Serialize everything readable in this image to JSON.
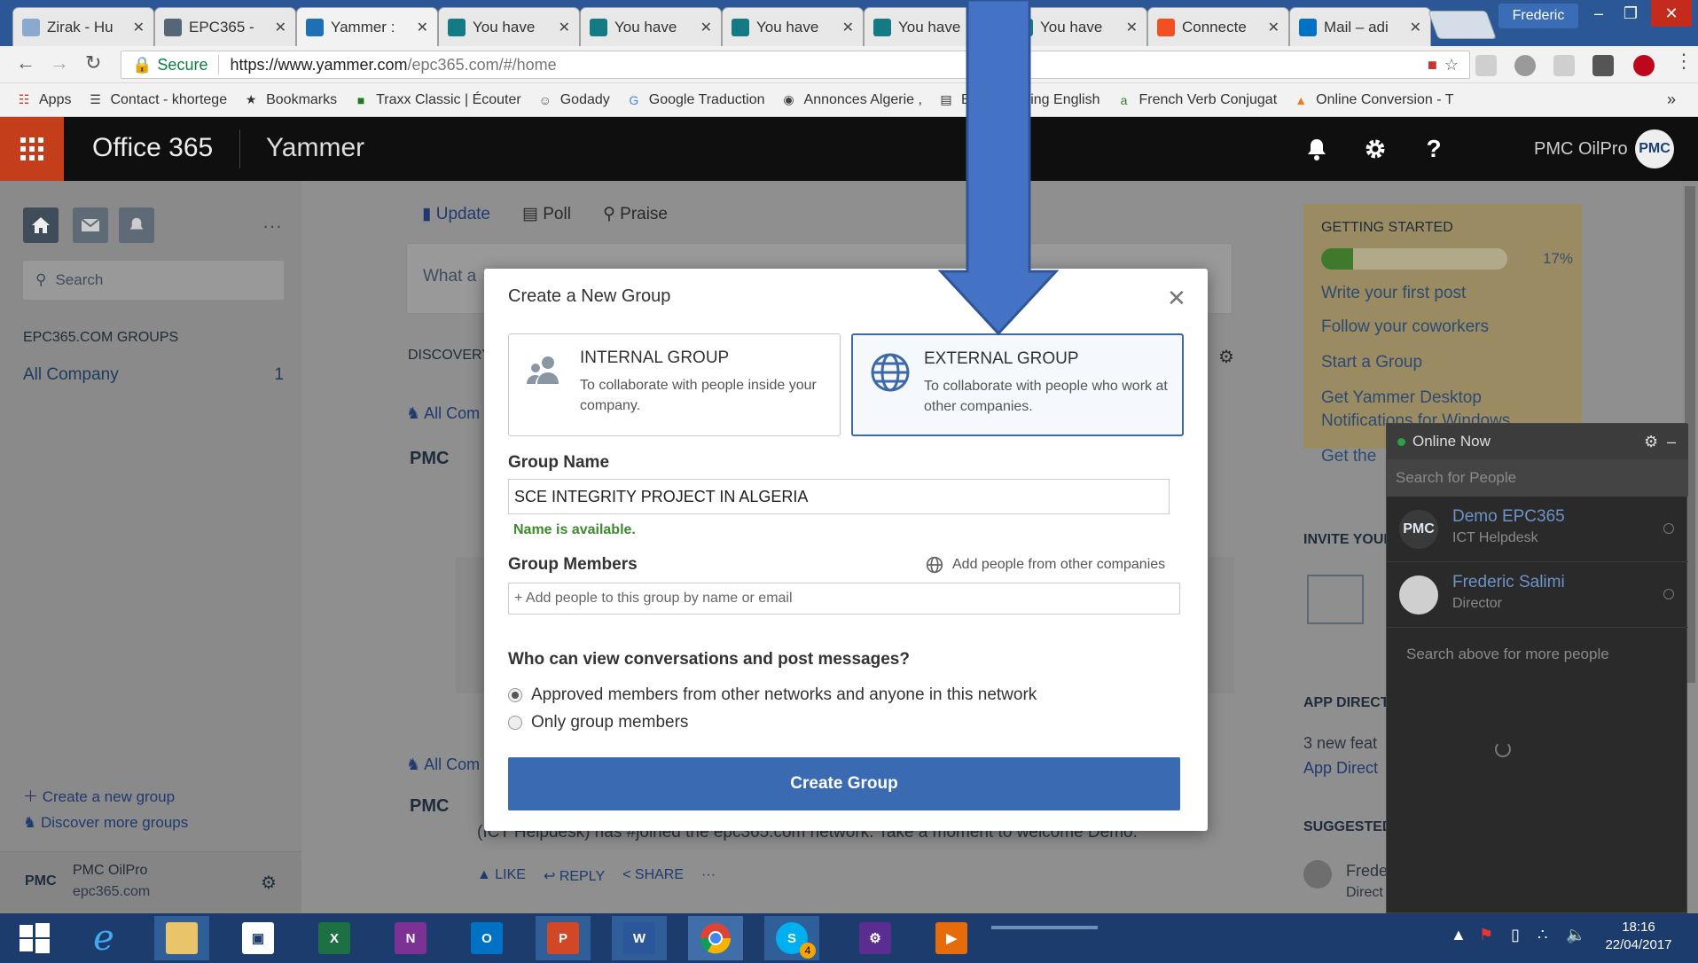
{
  "browser": {
    "tabs": [
      {
        "title": "Zirak - Hu",
        "fav_color": "#8aa9cf"
      },
      {
        "title": "EPC365 - ",
        "fav_color": "#567"
      },
      {
        "title": "Yammer : ",
        "fav_color": "#1f6fb5",
        "active": true
      },
      {
        "title": "You have",
        "fav_color": "#127b84"
      },
      {
        "title": "You have",
        "fav_color": "#127b84"
      },
      {
        "title": "You have",
        "fav_color": "#127b84"
      },
      {
        "title": "You have",
        "fav_color": "#127b84"
      },
      {
        "title": "You have",
        "fav_color": "#127b84"
      },
      {
        "title": "Connecte",
        "fav_color": "#f25022"
      },
      {
        "title": "Mail – adi",
        "fav_color": "#0072c6"
      }
    ],
    "profile_name": "Frederic",
    "secure_label": "Secure",
    "url_host": "https://www.yammer.com",
    "url_path": "/epc365.com/#/home",
    "bookmarks": [
      {
        "label": "Apps",
        "icon": "apps-grid-icon"
      },
      {
        "label": "Contact - khortege",
        "icon": "contact-icon"
      },
      {
        "label": "Bookmarks",
        "icon": "star-icon"
      },
      {
        "label": "Traxx Classic | Écouter",
        "icon": "traxx-icon"
      },
      {
        "label": "Godady",
        "icon": "godaddy-icon"
      },
      {
        "label": "Google Traduction",
        "icon": "google-translate-icon"
      },
      {
        "label": "Annonces Algerie ,",
        "icon": "annonces-icon"
      },
      {
        "label": "BBC Learning English",
        "icon": "bbc-icon"
      },
      {
        "label": "French Verb Conjugat",
        "icon": "conjugation-icon"
      },
      {
        "label": "Online Conversion - T",
        "icon": "conversion-icon"
      }
    ],
    "overflow_label": "»"
  },
  "header": {
    "brand": "Office 365",
    "app": "Yammer",
    "user_name": "PMC OilPro",
    "avatar_text": "PMC"
  },
  "left": {
    "search_placeholder": "Search",
    "groups_heading": "EPC365.COM GROUPS",
    "group_item": "All Company",
    "group_count": "1",
    "create_group": "Create a new group",
    "discover_groups": "Discover more groups",
    "footer_abbr": "PMC",
    "footer_name": "PMC OilPro",
    "footer_domain": "epc365.com"
  },
  "center": {
    "publisher_tabs": [
      "Update",
      "Poll",
      "Praise"
    ],
    "publisher_placeholder": "What a",
    "discovery_label": "DISCOVERY",
    "feed_group": "All Com",
    "post_abbr": "PMC",
    "post_text": "(ICT Helpdesk) has #joined the epc365.com network. Take a moment to welcome Demo.",
    "actions": [
      "LIKE",
      "REPLY",
      "SHARE",
      "···"
    ]
  },
  "right": {
    "getting_started_title": "GETTING STARTED",
    "progress_percent": 17,
    "progress_label": "17%",
    "steps": [
      "Write your first post",
      "Follow your coworkers",
      "Start a Group",
      "Get Yammer Desktop",
      "Notifications for Windows",
      "Get the"
    ],
    "invite_heading": "INVITE YOUR",
    "app_dir_heading": "APP DIRECT",
    "app_dir_line1": "3 new feat",
    "app_dir_line2": "App Direct",
    "suggested_heading": "SUGGESTED",
    "suggested_name": "Frede",
    "suggested_title": "Direct"
  },
  "modal": {
    "title": "Create a New Group",
    "internal_title": "INTERNAL GROUP",
    "internal_desc": "To collaborate with people inside your company.",
    "external_title": "EXTERNAL GROUP",
    "external_desc": "To collaborate with people who work at other companies.",
    "group_name_label": "Group Name",
    "group_name_value": "SCE INTEGRITY PROJECT IN ALGERIA",
    "availability": "Name is available.",
    "members_label": "Group Members",
    "add_external": "Add people from other companies",
    "members_placeholder": "+ Add people to this group by name or email",
    "visibility_question": "Who can view conversations and post messages?",
    "option_approved": "Approved members from other networks and anyone in this network",
    "option_members": "Only group members",
    "selected_option": "approved",
    "create_button": "Create Group"
  },
  "online_now": {
    "title": "Online Now",
    "search_placeholder": "Search for People",
    "people": [
      {
        "abbr": "PMC",
        "name": "Demo EPC365",
        "title": "ICT Helpdesk"
      },
      {
        "abbr": "",
        "name": "Frederic Salimi",
        "title": "Director"
      }
    ],
    "more_hint": "Search above for more people"
  },
  "taskbar": {
    "time": "18:16",
    "date": "22/04/2017",
    "skype_badge": "4"
  },
  "colors": {
    "o365_accent": "#c43e1c",
    "primary_button": "#3a6ab2",
    "link": "#6d93c9",
    "success": "#3c8a2e",
    "annotation_arrow": "#4472c4"
  }
}
